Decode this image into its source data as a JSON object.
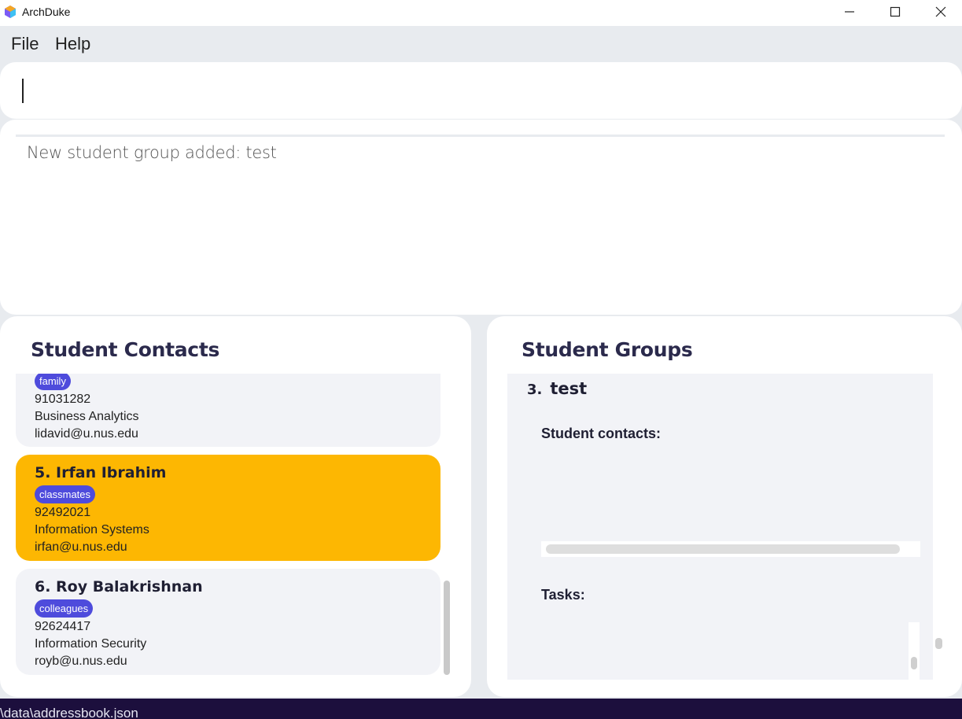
{
  "window": {
    "title": "ArchDuke",
    "controls": [
      "minimize",
      "maximize",
      "close"
    ]
  },
  "menu": {
    "file_label": "File",
    "help_label": "Help"
  },
  "command_box": {
    "value": "",
    "placeholder": ""
  },
  "result_display": {
    "message": "New student group added: test"
  },
  "contacts_panel": {
    "title": "Student Contacts",
    "cards": [
      {
        "name": "",
        "tag": "family",
        "phone": "91031282",
        "major": "Business Analytics",
        "email": "lidavid@u.nus.edu"
      },
      {
        "name": "5.  Irfan Ibrahim",
        "tag": "classmates",
        "phone": "92492021",
        "major": "Information Systems",
        "email": "irfan@u.nus.edu",
        "selected": true
      },
      {
        "name": "6.  Roy Balakrishnan",
        "tag": "colleagues",
        "phone": "92624417",
        "major": "Information Security",
        "email": "royb@u.nus.edu"
      }
    ]
  },
  "groups_panel": {
    "title": "Student Groups",
    "group": {
      "index": "3.",
      "name": "test",
      "contacts_label": "Student contacts:",
      "tasks_label": "Tasks:"
    }
  },
  "status_bar": {
    "path": "\\data\\addressbook.json"
  },
  "colors": {
    "accent_tag": "#4e4bdc",
    "selected_card": "#fdb702",
    "status_bar": "#1c0f3d",
    "title_text": "#2b2a4c"
  }
}
